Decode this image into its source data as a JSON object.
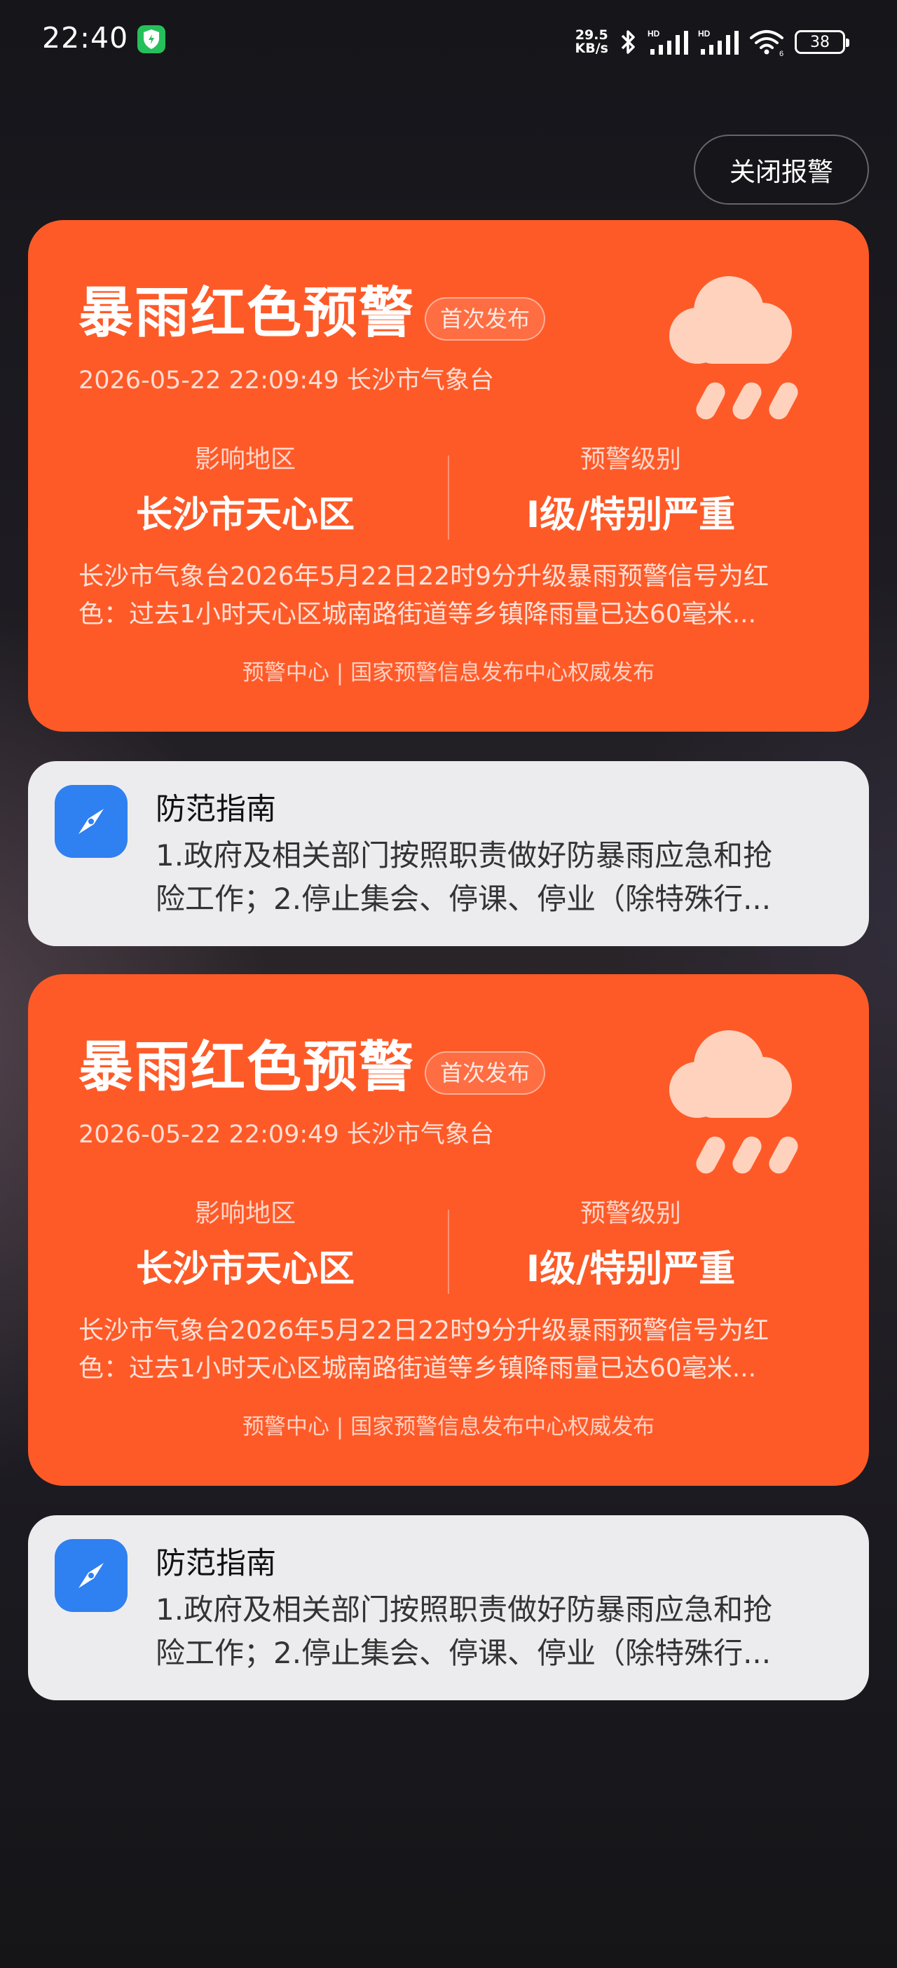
{
  "status_bar": {
    "time": "22:40",
    "net_speed_value": "29.5",
    "net_speed_unit": "KB/s",
    "battery": "38"
  },
  "close_button_label": "关闭报警",
  "alerts": [
    {
      "title": "暴雨红色预警",
      "badge": "首次发布",
      "meta": "2026-05-22 22:09:49 长沙市气象台",
      "area_label": "影响地区",
      "area_value": "长沙市天心区",
      "level_label": "预警级别",
      "level_value": "I级/特别严重",
      "desc_line1": "长沙市气象台2026年5月22日22时9分升级暴雨预警信号为红",
      "desc_line2": "色：过去1小时天心区城南路街道等乡镇降雨量已达60毫米...",
      "source": "预警中心 | 国家预警信息发布中心权威发布"
    },
    {
      "title": "暴雨红色预警",
      "badge": "首次发布",
      "meta": "2026-05-22 22:09:49 长沙市气象台",
      "area_label": "影响地区",
      "area_value": "长沙市天心区",
      "level_label": "预警级别",
      "level_value": "I级/特别严重",
      "desc_line1": "长沙市气象台2026年5月22日22时9分升级暴雨预警信号为红",
      "desc_line2": "色：过去1小时天心区城南路街道等乡镇降雨量已达60毫米...",
      "source": "预警中心 | 国家预警信息发布中心权威发布"
    }
  ],
  "guides": [
    {
      "title": "防范指南",
      "line1": "1.政府及相关部门按照职责做好防暴雨应急和抢",
      "line2": "险工作；2.停止集会、停课、停业（除特殊行..."
    },
    {
      "title": "防范指南",
      "line1": "1.政府及相关部门按照职责做好防暴雨应急和抢",
      "line2": "险工作；2.停止集会、停课、停业（除特殊行..."
    }
  ],
  "colors": {
    "alert_orange": "#fe5a28",
    "guide_bg": "#ececef",
    "guide_icon_blue": "#2f80f0"
  }
}
